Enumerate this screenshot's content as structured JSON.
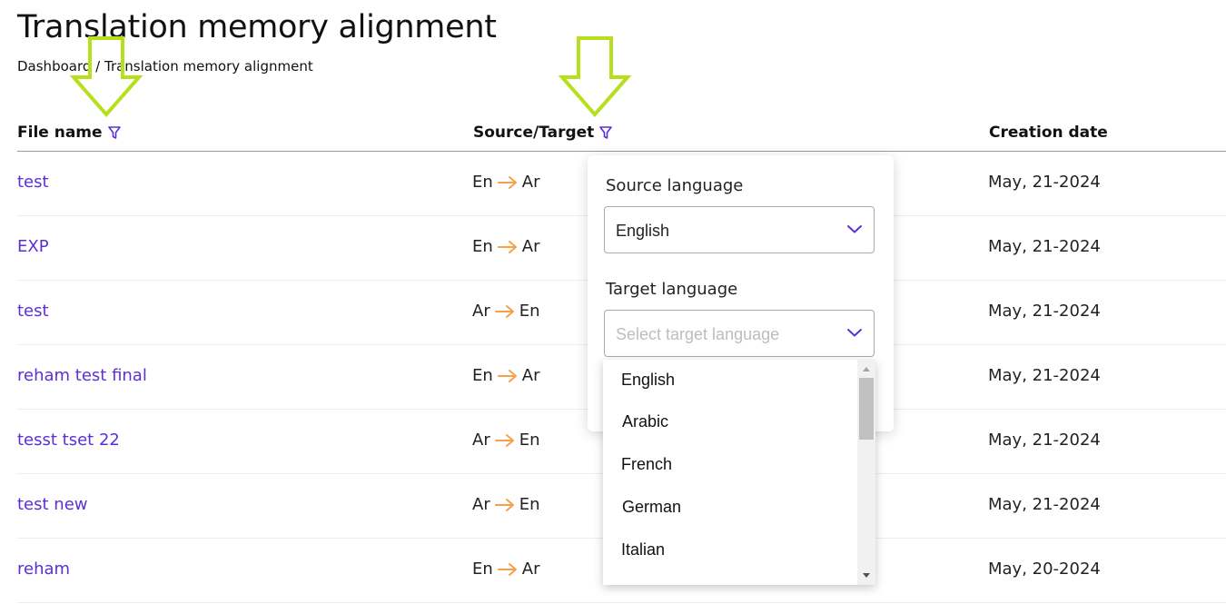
{
  "page": {
    "title": "Translation memory alignment",
    "breadcrumb": {
      "home": "Dashboard",
      "separator": " / ",
      "current": "Translation memory alignment"
    }
  },
  "table": {
    "columns": {
      "file_name": "File name",
      "source_target": "Source/Target",
      "creation_date": "Creation date"
    },
    "rows": [
      {
        "file": "test",
        "source": "En",
        "target": "Ar",
        "date": "May, 21-2024"
      },
      {
        "file": "EXP",
        "source": "En",
        "target": "Ar",
        "date": "May, 21-2024"
      },
      {
        "file": "test",
        "source": "Ar",
        "target": "En",
        "date": "May, 21-2024"
      },
      {
        "file": "reham test final",
        "source": "En",
        "target": "Ar",
        "date": "May, 21-2024"
      },
      {
        "file": "tesst tset 22",
        "source": "Ar",
        "target": "En",
        "date": "May, 21-2024"
      },
      {
        "file": "test new",
        "source": "Ar",
        "target": "En",
        "date": "May, 21-2024"
      },
      {
        "file": "reham",
        "source": "En",
        "target": "Ar",
        "date": "May, 20-2024"
      }
    ]
  },
  "filter_panel": {
    "source_label": "Source language",
    "source_value": "English",
    "target_label": "Target language",
    "target_placeholder": "Select target language",
    "options": [
      "English",
      "Arabic",
      "French",
      "German",
      "Italian"
    ]
  },
  "icons": {
    "filter": "filter-icon",
    "arrow": "arrow-right-icon",
    "chevron": "chevron-down-icon",
    "annotation": "annotation-arrow-icon"
  },
  "colors": {
    "accent": "#5b2fd6",
    "pair_arrow": "#f5a04a",
    "annotation": "#b6e01c"
  }
}
